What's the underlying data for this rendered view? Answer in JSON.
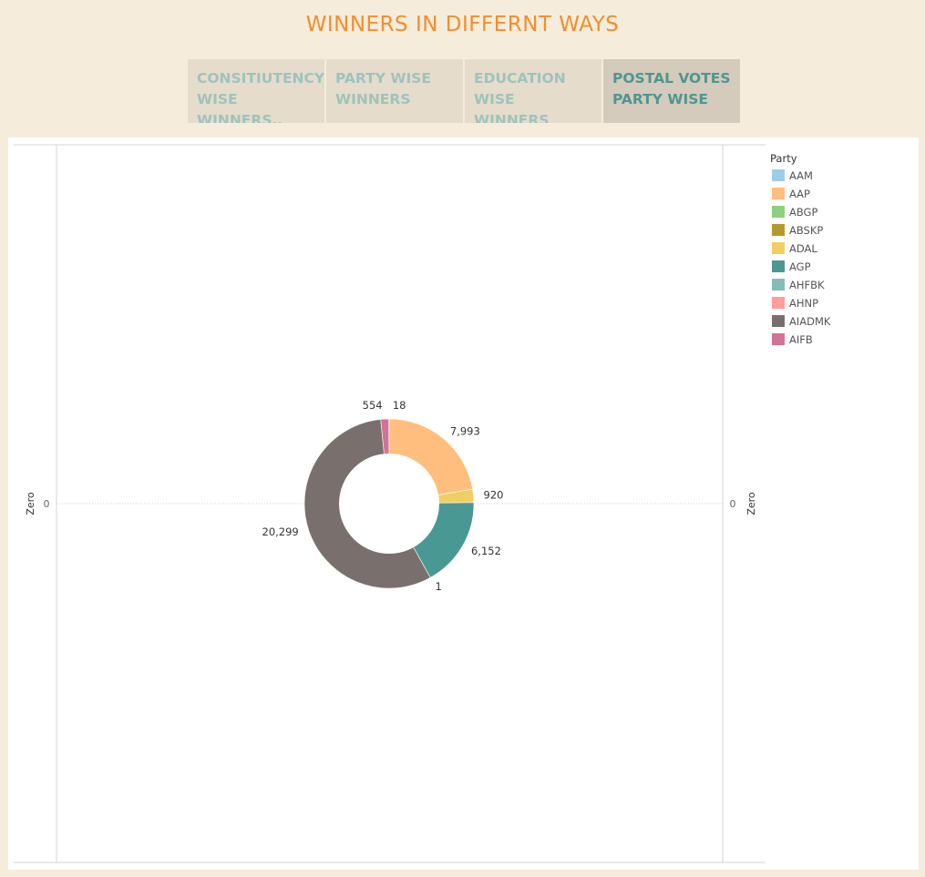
{
  "dashboard": {
    "title": "WINNERS IN DIFFERNT WAYS",
    "tabs": [
      {
        "label": "CONSITIUTENCY\nWISE WINNERS..",
        "active": false
      },
      {
        "label": "PARTY WISE\nWINNERS",
        "active": false
      },
      {
        "label": "EDUCATION\nWISE WINNERS",
        "active": false
      },
      {
        "label": "POSTAL VOTES\nPARTY WISE",
        "active": true
      }
    ]
  },
  "axes": {
    "left_label": "Zero",
    "right_label": "Zero",
    "left_tick": "0",
    "right_tick": "0"
  },
  "legend": {
    "title": "Party",
    "items": [
      {
        "label": "AAM",
        "color": "#a0cbe8"
      },
      {
        "label": "AAP",
        "color": "#ffbe7d"
      },
      {
        "label": "ABGP",
        "color": "#8cd17d"
      },
      {
        "label": "ABSKP",
        "color": "#b6992d"
      },
      {
        "label": "ADAL",
        "color": "#f1ce63"
      },
      {
        "label": "AGP",
        "color": "#499894"
      },
      {
        "label": "AHFBK",
        "color": "#86bcb6"
      },
      {
        "label": "AHNP",
        "color": "#ff9d9a"
      },
      {
        "label": "AIADMK",
        "color": "#79706e"
      },
      {
        "label": "AIFB",
        "color": "#d37295"
      }
    ]
  },
  "chart_data": {
    "type": "pie",
    "donut": true,
    "legend_title": "Party",
    "slices": [
      {
        "category": "AAP",
        "value": 7993,
        "label": "7,993",
        "color": "#ffbe7d"
      },
      {
        "category": "ADAL",
        "value": 920,
        "label": "920",
        "color": "#f1ce63"
      },
      {
        "category": "AGP",
        "value": 6152,
        "label": "6,152",
        "color": "#499894"
      },
      {
        "category": "AHFBK",
        "value": 1,
        "label": "1",
        "color": "#86bcb6"
      },
      {
        "category": "AIADMK",
        "value": 20299,
        "label": "20,299",
        "color": "#79706e"
      },
      {
        "category": "AIFB",
        "value": 554,
        "label": "554",
        "color": "#d37295"
      },
      {
        "category": "AAM",
        "value": 18,
        "label": "18",
        "color": "#a0cbe8"
      }
    ]
  }
}
